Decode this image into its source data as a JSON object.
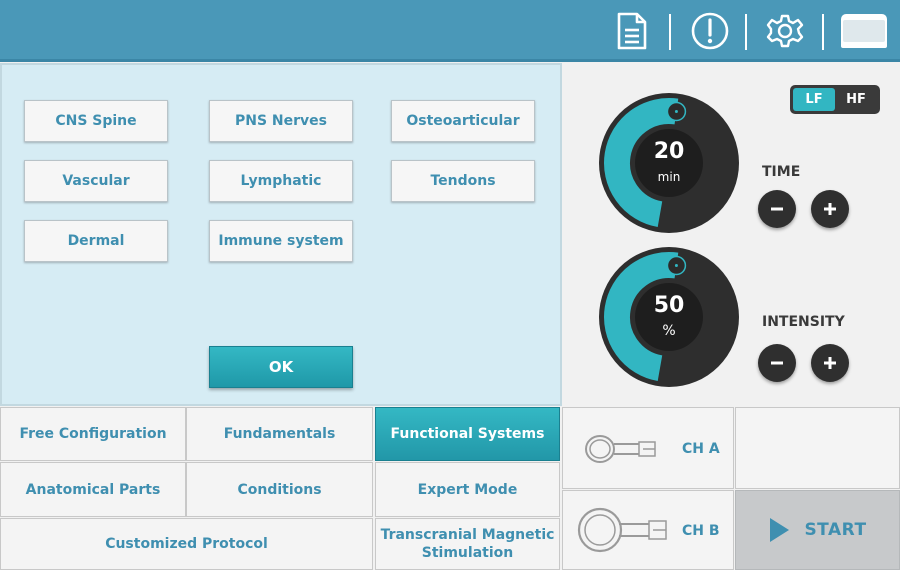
{
  "header": {
    "icons": [
      "document-icon",
      "alert-icon",
      "settings-icon",
      "device-icon"
    ]
  },
  "systems": {
    "items": [
      "CNS Spine",
      "PNS Nerves",
      "Osteoarticular",
      "Vascular",
      "Lymphatic",
      "Tendons",
      "Dermal",
      "Immune system"
    ],
    "ok_label": "OK"
  },
  "controls": {
    "mode_options": [
      "LF",
      "HF"
    ],
    "mode_selected": "LF",
    "time": {
      "value": "20",
      "unit": "min",
      "label": "TIME",
      "fraction": 0.55
    },
    "intensity": {
      "value": "50",
      "unit": "%",
      "label": "INTENSITY",
      "fraction": 0.55
    },
    "colors": {
      "accent": "#32b6c2",
      "dial_dark": "#2e2e2e",
      "header": "#4a98b8",
      "text_blue": "#3f8fb0"
    }
  },
  "tabs": {
    "free_configuration": "Free Configuration",
    "fundamentals": "Fundamentals",
    "functional_systems": "Functional Systems",
    "anatomical_parts": "Anatomical Parts",
    "conditions": "Conditions",
    "expert_mode": "Expert Mode",
    "customized_protocol": "Customized Protocol",
    "tms_line1": "Transcranial Magnetic",
    "tms_line2": "Stimulation",
    "active": "Functional Systems"
  },
  "channels": {
    "ch_a": "CH A",
    "ch_b": "CH B",
    "start_label": "START"
  }
}
